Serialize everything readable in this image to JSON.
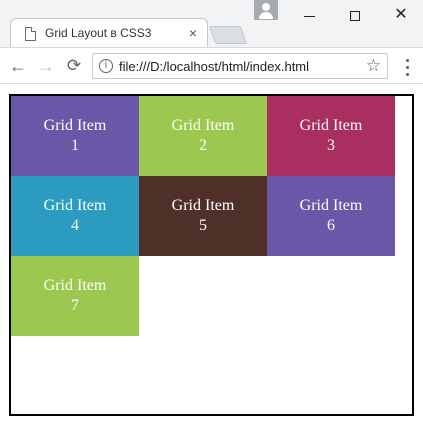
{
  "browser": {
    "tab_title": "Grid Layout в CSS3",
    "tab_close": "×",
    "window_close": "✕",
    "url": "file:///D:/localhost/html/index.html",
    "back_glyph": "←",
    "forward_glyph": "→",
    "reload_glyph": "⟳",
    "star_glyph": "☆",
    "info_glyph": "i"
  },
  "grid": {
    "items": [
      {
        "line1": "Grid Item",
        "line2": "1",
        "color": "#6b57a7"
      },
      {
        "line1": "Grid Item",
        "line2": "2",
        "color": "#9dc850"
      },
      {
        "line1": "Grid Item",
        "line2": "3",
        "color": "#a82f5f"
      },
      {
        "line1": "Grid Item",
        "line2": "4",
        "color": "#2b9cc0"
      },
      {
        "line1": "Grid Item",
        "line2": "5",
        "color": "#4e3029"
      },
      {
        "line1": "Grid Item",
        "line2": "6",
        "color": "#6b57a7"
      },
      {
        "line1": "Grid Item",
        "line2": "7",
        "color": "#9dc850"
      }
    ]
  }
}
